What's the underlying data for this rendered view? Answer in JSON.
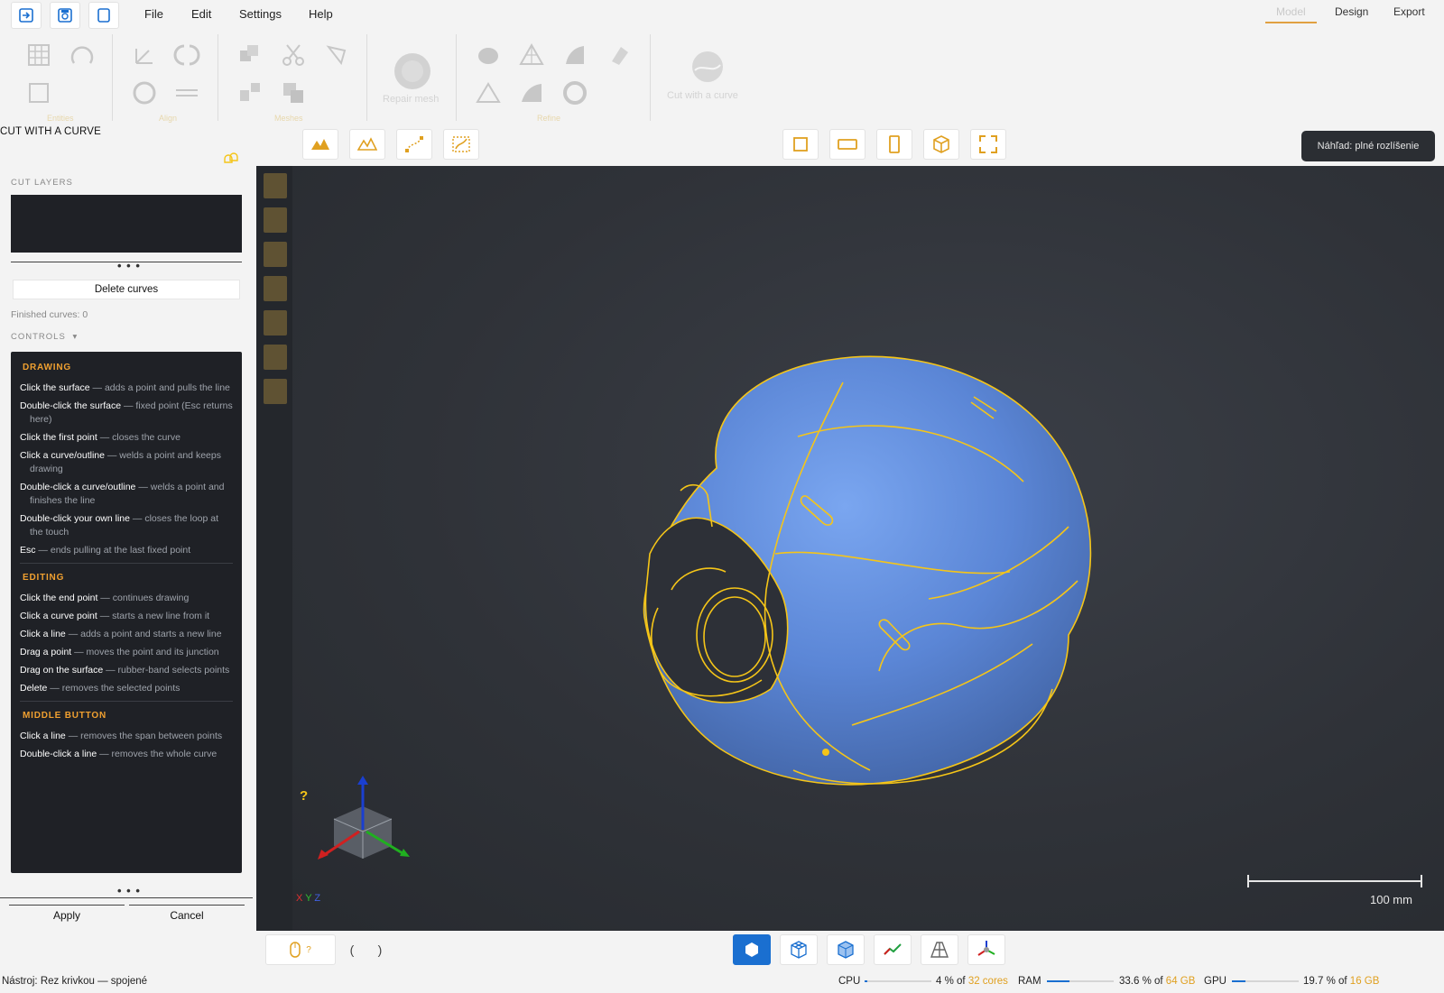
{
  "menu": {
    "items": [
      "File",
      "Edit",
      "Settings",
      "Help"
    ]
  },
  "tabs": {
    "model": "Model",
    "design": "Design",
    "export": "Export"
  },
  "ribbon": {
    "groups": [
      "Entities",
      "Align",
      "Meshes",
      "Refine"
    ],
    "repair_mesh": "Repair mesh",
    "cut_with_curve": "Cut with a curve"
  },
  "panel": {
    "title": "CUT WITH A CURVE",
    "cut_layers_label": "CUT LAYERS",
    "delete_curves": "Delete curves",
    "finished_curves": "Finished curves: 0",
    "controls_label": "CONTROLS",
    "controls_caret": "▾",
    "sections": [
      {
        "heading": "DRAWING",
        "items": [
          {
            "key": "Click the surface",
            "desc": " — adds a point and pulls the line"
          },
          {
            "key": "Double-click the surface",
            "desc": " — fixed point (Esc returns here)"
          },
          {
            "key": "Click the first point",
            "desc": " — closes the curve"
          },
          {
            "key": "Click a curve/outline",
            "desc": " — welds a point and keeps drawing"
          },
          {
            "key": "Double-click a curve/outline",
            "desc": " — welds a point and finishes the line"
          },
          {
            "key": "Double-click your own line",
            "desc": " — closes the loop at the touch"
          },
          {
            "key": "Esc",
            "desc": " — ends pulling at the last fixed point"
          }
        ]
      },
      {
        "heading": "EDITING",
        "items": [
          {
            "key": "Click the end point",
            "desc": " — continues drawing"
          },
          {
            "key": "Click a curve point",
            "desc": " — starts a new line from it"
          },
          {
            "key": "Click a line",
            "desc": " — adds a point and starts a new line"
          },
          {
            "key": "Drag a point",
            "desc": " — moves the point and its junction"
          },
          {
            "key": "Drag on the surface",
            "desc": " — rubber-band selects points"
          },
          {
            "key": "Delete",
            "desc": " — removes the selected points"
          }
        ]
      },
      {
        "heading": "MIDDLE BUTTON",
        "items": [
          {
            "key": "Click a line",
            "desc": " — removes the span between points"
          },
          {
            "key": "Double-click a line",
            "desc": " — removes the whole curve"
          }
        ]
      }
    ],
    "apply": "Apply",
    "cancel": "Cancel"
  },
  "viewport": {
    "preview_badge": "Náhľad: plné rozlíšenie",
    "help_mark": "?",
    "axis_x": "X",
    "axis_y": "Y",
    "axis_z": "Z",
    "scale_label": "100 mm",
    "accent": "#f5c518",
    "model_color": "#5b86d6"
  },
  "bottom": {
    "mouse_hint": "?",
    "bracket_left": "(",
    "bracket_right": ")"
  },
  "status": {
    "tool": "Nástroj: Rez krivkou — spojené",
    "cpu_label": "CPU",
    "cpu_value": "4 % of ",
    "cpu_cores": "32 cores",
    "cpu_fraction": 0.04,
    "ram_label": "RAM",
    "ram_value": "33.6 % of ",
    "ram_total": "64 GB",
    "ram_fraction": 0.336,
    "gpu_label": "GPU",
    "gpu_value": "19.7 % of ",
    "gpu_total": "16 GB",
    "gpu_fraction": 0.197
  }
}
